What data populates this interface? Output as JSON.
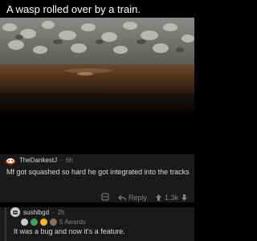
{
  "post": {
    "title": "A wasp rolled over by a train."
  },
  "comments": [
    {
      "author": "TheDankestJ",
      "separator": "·",
      "age": "6h",
      "body": "Mf got squashed so hard he got integrated into the tracks",
      "reply_label": "Reply",
      "score": "1.3k"
    },
    {
      "author": "sushibgd",
      "separator": "·",
      "age": "2h",
      "awards_label": "5 Awards",
      "body": "It was a bug and now it's a feature."
    }
  ],
  "colors": {
    "background": "#000000",
    "comment_bg": "#1a1a1b",
    "text": "#d7dadc",
    "muted": "#818384"
  }
}
